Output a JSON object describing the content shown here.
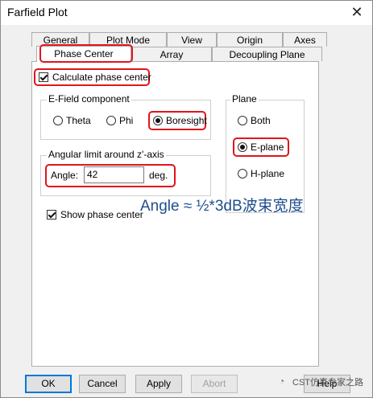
{
  "window": {
    "title": "Farfield Plot"
  },
  "tabs_row1": [
    "General",
    "Plot Mode",
    "View",
    "Origin",
    "Axes"
  ],
  "tabs_row2": [
    "Phase Center",
    "Array",
    "Decoupling Plane"
  ],
  "active_tab": "Phase Center",
  "calculate_phase_center": {
    "label": "Calculate phase center",
    "checked": true
  },
  "efield": {
    "group_label": "E-Field component",
    "options": [
      "Theta",
      "Phi",
      "Boresight"
    ],
    "selected": "Boresight"
  },
  "angular": {
    "group_label": "Angular limit around z'-axis",
    "angle_label": "Angle:",
    "angle_value": "42",
    "unit": "deg."
  },
  "plane": {
    "group_label": "Plane",
    "options": [
      "Both",
      "E-plane",
      "H-plane"
    ],
    "selected": "E-plane"
  },
  "show_phase_center": {
    "label": "Show phase center",
    "checked": true
  },
  "annotation": "Angle ≈ ½*3dB波束宽度",
  "buttons": {
    "ok": "OK",
    "cancel": "Cancel",
    "apply": "Apply",
    "abort": "Abort",
    "help": "Help"
  },
  "watermark": "CST仿真专家之路",
  "colors": {
    "highlight_red": "#e0151b",
    "annotation_blue": "#1f4e8c",
    "default_button_border": "#0078d7"
  },
  "icons": {
    "close": "close-icon",
    "watermark": "wechat-icon"
  }
}
